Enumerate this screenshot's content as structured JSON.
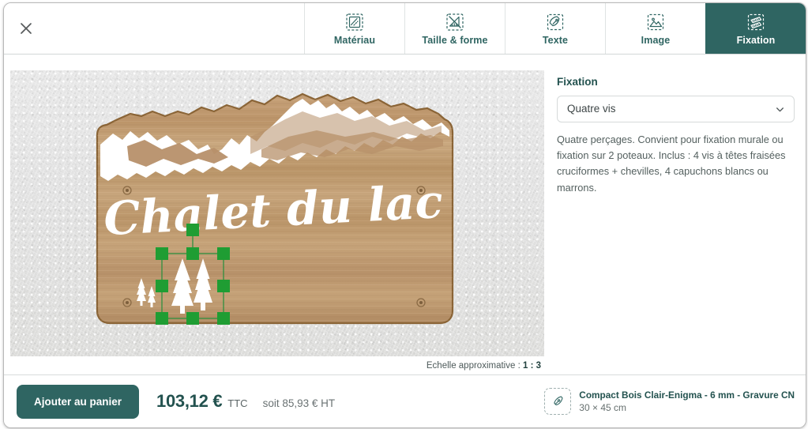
{
  "header": {
    "close_label": "×",
    "close_icon": "close-icon",
    "tabs": [
      {
        "label": "Matériau",
        "icon": "material-swatch-icon",
        "active": false
      },
      {
        "label": "Taille & forme",
        "icon": "size-shape-ruler-icon",
        "active": false
      },
      {
        "label": "Texte",
        "icon": "text-pen-icon",
        "active": false
      },
      {
        "label": "Image",
        "icon": "image-picture-icon",
        "active": false
      },
      {
        "label": "Fixation",
        "icon": "fixation-screws-icon",
        "active": true
      }
    ]
  },
  "canvas": {
    "sign_text": "Chalet du lac",
    "scale_label": "Echelle approximative :",
    "scale_value": "1 : 3",
    "object_toolbar": [
      {
        "name": "delete-object-button",
        "icon": "trash-icon"
      },
      {
        "name": "flip-vertical-button",
        "icon": "flip-vertical-icon"
      },
      {
        "name": "flip-horizontal-button",
        "icon": "flip-horizontal-icon"
      },
      {
        "name": "undo-button",
        "icon": "rotate-left-icon"
      },
      {
        "name": "redo-button",
        "icon": "rotate-right-icon"
      }
    ]
  },
  "panel": {
    "title": "Fixation",
    "select_value": "Quatre vis",
    "select_options": [
      "Quatre vis"
    ],
    "description": "Quatre perçages. Convient pour fixation murale ou fixation sur 2 poteaux. Inclus : 4 vis à têtes fraisées cruciformes + chevilles, 4 capuchons blancs ou marrons."
  },
  "footer": {
    "cart_button": "Ajouter au panier",
    "price_ttc_value": "103,12 €",
    "price_ttc_suffix": "TTC",
    "price_ht": "soit 85,93 € HT",
    "product_name": "Compact Bois Clair-Enigma - 6 mm - Gravure CN",
    "product_dims": "30 × 45 cm",
    "product_icon": "pen-nib-icon"
  },
  "colors": {
    "accent": "#2f6562",
    "accent_text": "#23524f",
    "selection_handle": "#1f9d33",
    "wood_light": "#c9a477",
    "wood_dark": "#9c7a4e",
    "wall": "#e4e4e2"
  }
}
